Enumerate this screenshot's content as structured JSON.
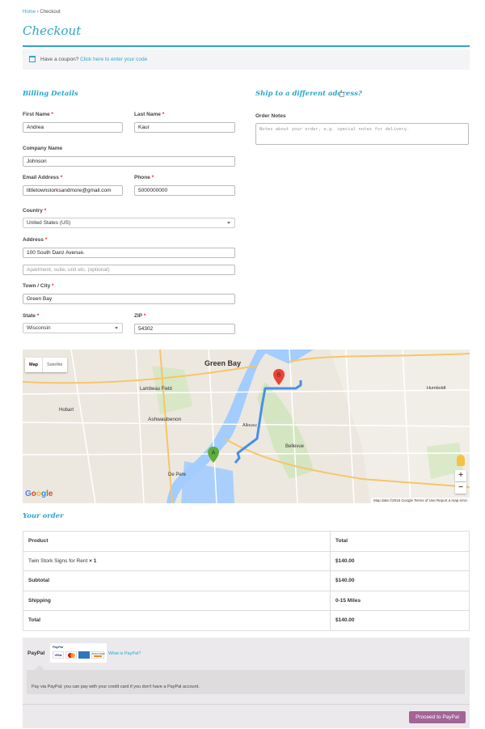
{
  "breadcrumb": {
    "home": "Home",
    "sep": " › ",
    "current": "Checkout"
  },
  "page_title": "Checkout",
  "coupon": {
    "text": "Have a coupon?",
    "link": "Click here to enter your code"
  },
  "billing": {
    "heading": "Billing Details",
    "required_mark": "*",
    "first_name": {
      "label": "First Name",
      "value": "Andrea"
    },
    "last_name": {
      "label": "Last Name",
      "value": "Kaur"
    },
    "company": {
      "label": "Company Name",
      "value": "Johnson"
    },
    "email": {
      "label": "Email Address",
      "value": "littletownstorksandmore@gmail.com"
    },
    "phone": {
      "label": "Phone",
      "value": "5000000000"
    },
    "country": {
      "label": "Country",
      "value": "United States (US)"
    },
    "address": {
      "label": "Address",
      "value": "100 South Danz Avenue.",
      "placeholder2": "Apartment, suite, unit etc. (optional)"
    },
    "city": {
      "label": "Town / City",
      "value": "Green Bay"
    },
    "state": {
      "label": "State",
      "value": "Wisconsin"
    },
    "zip": {
      "label": "ZIP",
      "value": "54302"
    }
  },
  "shipping": {
    "heading": "Ship to a different address?",
    "notes_label": "Order Notes",
    "notes_placeholder": "Notes about your order, e.g. special notes for delivery."
  },
  "map": {
    "type_map": "Map",
    "type_satellite": "Satellite",
    "zoom_in": "+",
    "zoom_out": "−",
    "logo": "Google",
    "footer": "Map data ©2016 Google   Terms of Use   Report a map error",
    "labels": {
      "green_bay": "Green Bay",
      "lambeau": "Lambeau Field",
      "ashwaubenon": "Ashwaubenon",
      "allouez": "Allouez",
      "bellevue": "Bellevue",
      "de_pere": "De Pere",
      "hobart": "Hobart",
      "humboldt": "Humboldt"
    },
    "marker_a": "A",
    "marker_b": "B",
    "colors": {
      "water": "#a3ccff",
      "route": "#4a8fe6",
      "park": "#cbe6b4"
    }
  },
  "order": {
    "heading": "Your order",
    "col_product": "Product",
    "col_total": "Total",
    "items": [
      {
        "name": "Twin Stork Signs for Rent",
        "qty": "× 1",
        "total": "$140.00"
      }
    ],
    "subtotal_label": "Subtotal",
    "subtotal": "$140.00",
    "shipping_label": "Shipping",
    "shipping": "0-15 Miles",
    "total_label": "Total",
    "total": "$140.00"
  },
  "payment": {
    "method": "PayPal",
    "logo_text": "PayPal",
    "cards": [
      "VISA",
      "MC",
      "AMEX",
      "DISCOVER"
    ],
    "what_link": "What is PayPal?",
    "description": "Pay via PayPal; you can pay with your credit card if you don't have a PayPal account.",
    "button": "Proceed to PayPal",
    "button_color": "#a46497"
  }
}
